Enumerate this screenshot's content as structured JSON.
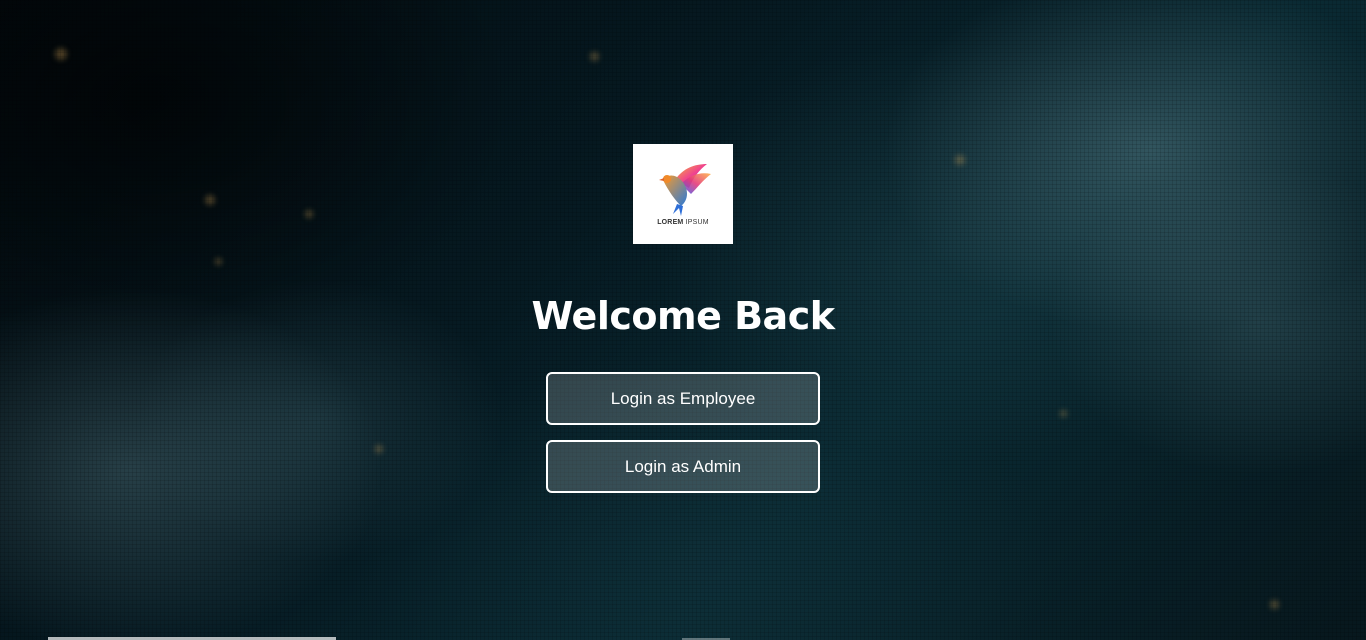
{
  "logo": {
    "text_bold": "LOREM",
    "text_light": "IPSUM"
  },
  "heading": "Welcome Back",
  "buttons": {
    "employee": "Login as Employee",
    "admin": "Login as Admin"
  },
  "colors": {
    "button_border": "#ffffff",
    "text": "#ffffff",
    "background": "#061a22"
  }
}
